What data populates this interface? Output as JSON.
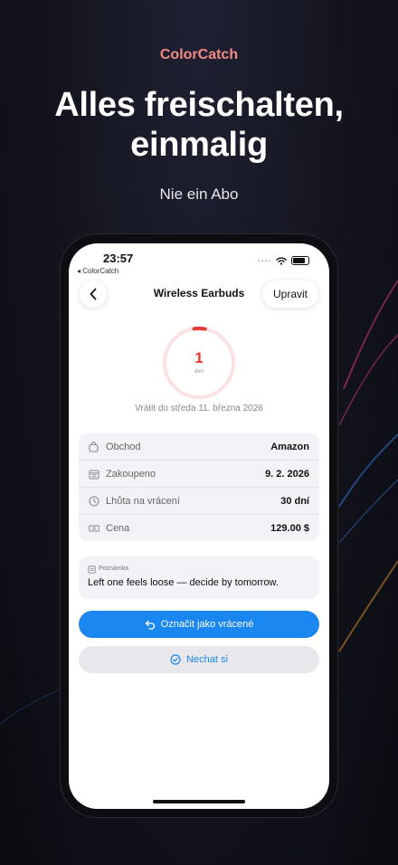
{
  "promo": {
    "brand": "ColorCatch",
    "headline_line1": "Alles freischalten,",
    "headline_line2": "einmalig",
    "subheadline": "Nie ein Abo"
  },
  "status_bar": {
    "time": "23:57",
    "back_app": "◂ ColorCatch"
  },
  "nav": {
    "title": "Wireless Earbuds",
    "edit_label": "Upravit"
  },
  "countdown": {
    "value": "1",
    "unit": "den",
    "progress_fraction": 0.05,
    "return_by": "Vrátit do středa 11. března 2026"
  },
  "details": [
    {
      "icon": "shopping-bag-icon",
      "label": "Obchod",
      "value": "Amazon"
    },
    {
      "icon": "calendar-icon",
      "label": "Zakoupeno",
      "value": "9. 2. 2026"
    },
    {
      "icon": "clock-icon",
      "label": "Lhůta na vrácení",
      "value": "30 dní"
    },
    {
      "icon": "banknote-icon",
      "label": "Cena",
      "value": "129.00 $"
    }
  ],
  "note": {
    "label": "Poznámka",
    "text": "Left one feels loose — decide by tomorrow."
  },
  "actions": {
    "primary": "Označit jako vrácené",
    "secondary": "Nechat si"
  },
  "colors": {
    "brand": "#f28b86",
    "accent": "#1a86f0",
    "countdown": "#e53935"
  }
}
